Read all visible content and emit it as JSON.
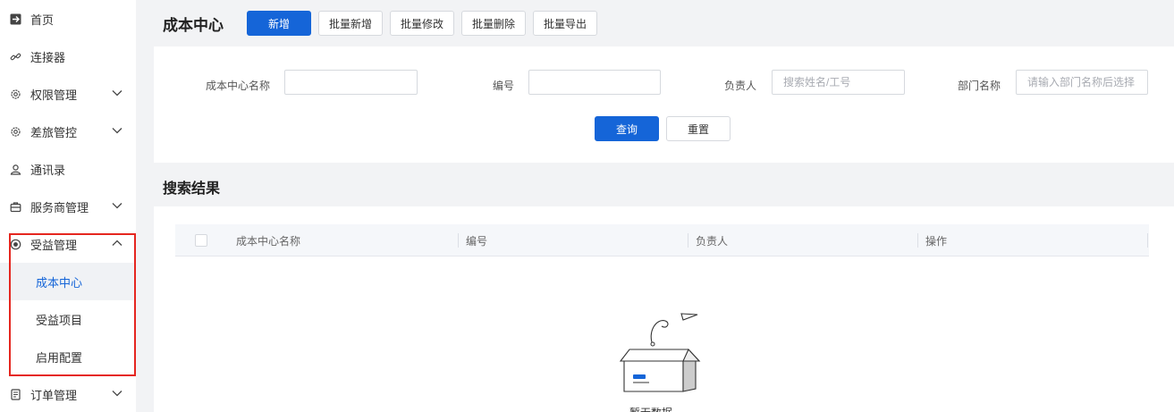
{
  "sidebar": {
    "items": [
      {
        "label": "首页",
        "icon": "plane-icon"
      },
      {
        "label": "连接器",
        "icon": "link-icon"
      },
      {
        "label": "权限管理",
        "icon": "gear-icon"
      },
      {
        "label": "差旅管控",
        "icon": "gear-icon"
      },
      {
        "label": "通讯录",
        "icon": "contacts-icon"
      },
      {
        "label": "服务商管理",
        "icon": "briefcase-icon"
      },
      {
        "label": "受益管理",
        "icon": "benefit-icon"
      },
      {
        "label": "订单管理",
        "icon": "order-icon"
      }
    ],
    "sub_items": [
      {
        "label": "成本中心",
        "active": true
      },
      {
        "label": "受益项目",
        "active": false
      },
      {
        "label": "启用配置",
        "active": false
      }
    ],
    "highlight_color": "#e5261f"
  },
  "toolbar": {
    "title": "成本中心",
    "new_label": "新增",
    "batch_add_label": "批量新增",
    "batch_edit_label": "批量修改",
    "batch_delete_label": "批量删除",
    "batch_export_label": "批量导出"
  },
  "search": {
    "name_label": "成本中心名称",
    "name_value": "",
    "code_label": "编号",
    "code_value": "",
    "owner_label": "负责人",
    "owner_placeholder": "搜索姓名/工号",
    "dept_label": "部门名称",
    "dept_placeholder": "请输入部门名称后选择",
    "query_label": "查询",
    "reset_label": "重置"
  },
  "results": {
    "title": "搜索结果",
    "columns": [
      "成本中心名称",
      "编号",
      "负责人",
      "操作"
    ],
    "empty_text": "暂无数据"
  },
  "colors": {
    "accent": "#1565d8",
    "background": "#f2f3f5"
  }
}
